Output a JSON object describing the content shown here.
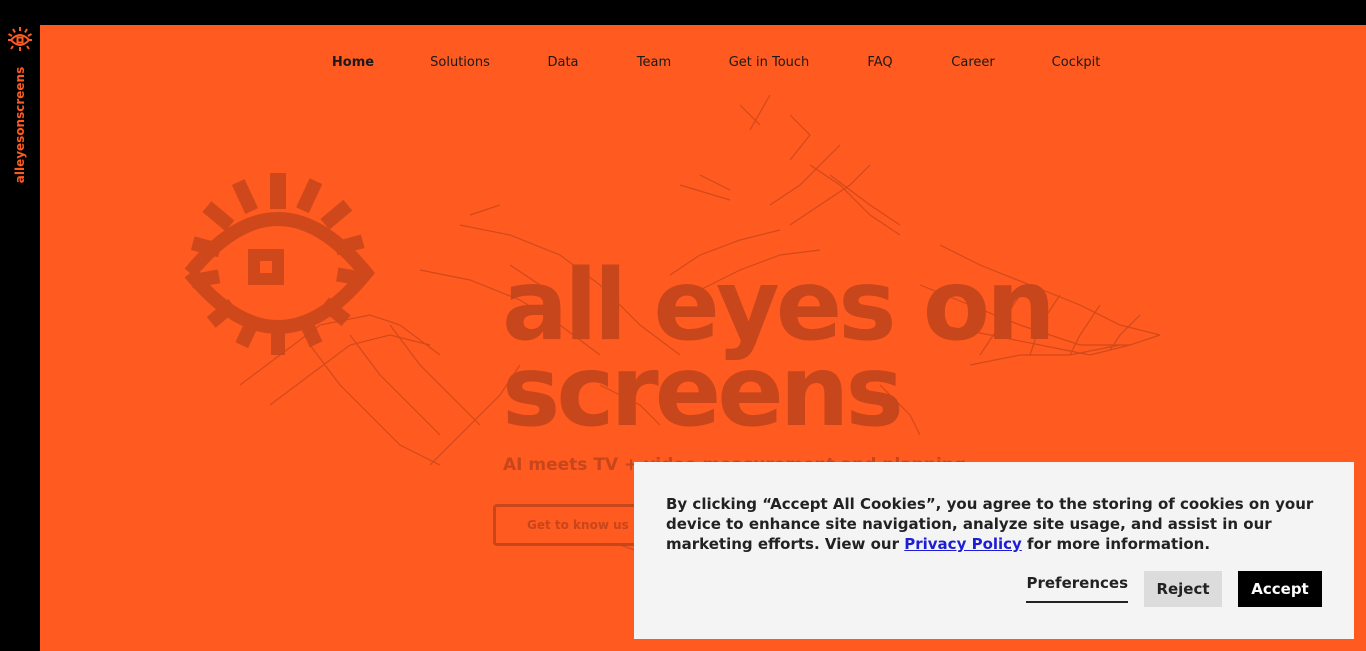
{
  "brand": {
    "side_wordmark": "alleyesonscreens",
    "accent_color": "#ff5a1f",
    "logo_icon": "eye-sun-icon"
  },
  "nav": {
    "items": [
      {
        "label": "Home",
        "active": true
      },
      {
        "label": "Solutions",
        "active": false
      },
      {
        "label": "Data",
        "active": false
      },
      {
        "label": "Team",
        "active": false
      },
      {
        "label": "Get in Touch",
        "active": false
      },
      {
        "label": "FAQ",
        "active": false
      },
      {
        "label": "Career",
        "active": false
      },
      {
        "label": "Cockpit",
        "active": false
      }
    ]
  },
  "hero": {
    "title_line1": "all eyes on",
    "title_line2": "screens",
    "subtitle": "AI meets TV + video measurement and planning",
    "cta_label": "Get to know us",
    "text_color": "#c7461b"
  },
  "cookie": {
    "text_before": "By clicking “Accept All Cookies”, you agree to the storing of cookies on your device to enhance site navigation, analyze site usage, and assist in our marketing efforts. View our ",
    "link_label": "Privacy Policy",
    "text_after": " for more information.",
    "preferences_label": "Preferences",
    "reject_label": "Reject",
    "accept_label": "Accept"
  }
}
